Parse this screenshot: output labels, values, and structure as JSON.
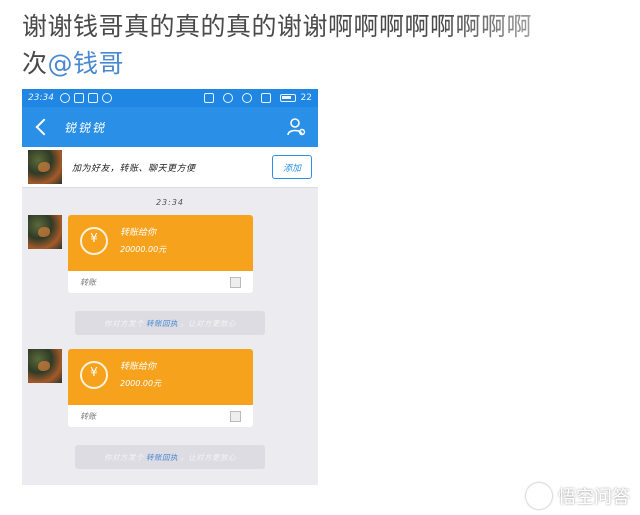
{
  "post": {
    "line1": "谢谢钱哥真的真的真的谢谢啊啊啊啊啊啊啊啊",
    "line2_prefix": "次",
    "mention": "@钱哥"
  },
  "phone": {
    "statusbar": {
      "time": "23:34",
      "right": "22"
    },
    "titlebar": {
      "title": "锐锐锐",
      "profile_icon": "person-settings-icon",
      "back_icon": "chevron-left-icon"
    },
    "friend_bar": {
      "text": "加为好友，转账、聊天更方便",
      "add_label": "添加"
    },
    "chat_time": "23:34",
    "messages": [
      {
        "title": "转账给你",
        "amount": "20000.00元",
        "footer": "转账",
        "icon": "transfer-icon"
      },
      {
        "title": "转账给你",
        "amount": "2000.00元",
        "footer": "转账",
        "icon": "transfer-icon"
      }
    ],
    "notices": [
      {
        "before": "你对方发个",
        "link": "转账回执",
        "after": "，让对方更放心"
      },
      {
        "before": "你对方发个",
        "link": "转账回执",
        "after": "，让对方更放心"
      }
    ],
    "colors": {
      "accent": "#2a8fe6",
      "transfer_orange": "#f6a21c",
      "mention": "#4a88d2"
    }
  },
  "watermark": {
    "text": "悟空问答",
    "icon": "wukong-logo-icon"
  }
}
